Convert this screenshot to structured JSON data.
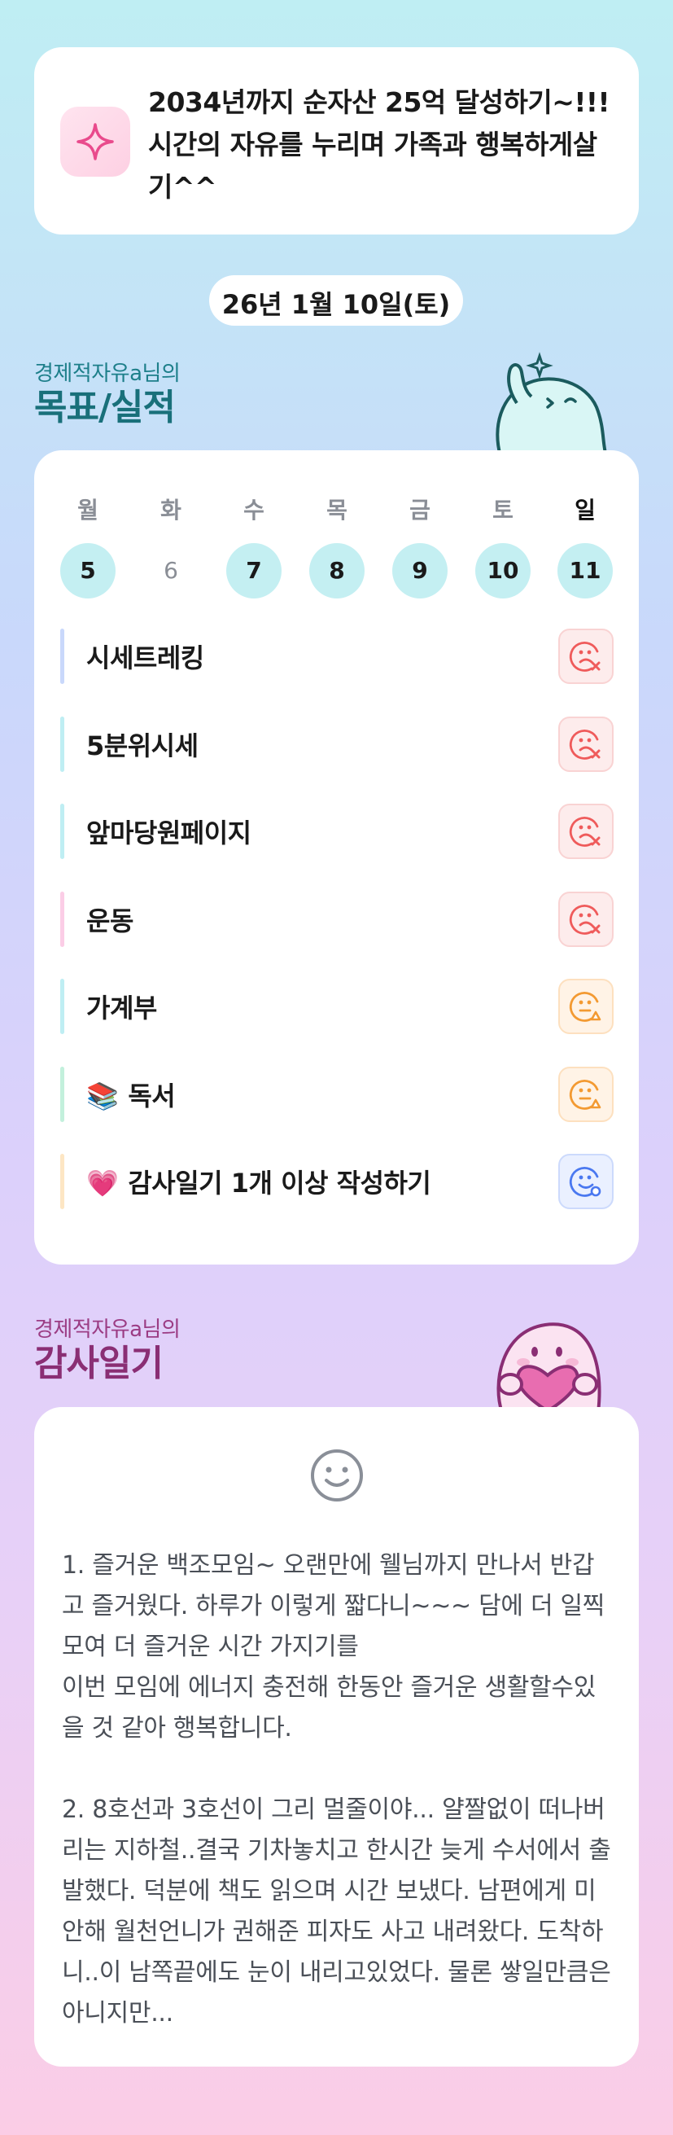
{
  "goal": {
    "icon": "sparkle-icon",
    "text": "2034년까지 순자산 25억 달성하기~!!!\n시간의 자유를 누리며 가족과 행복하게살기^^"
  },
  "date": "26년 1월 10일(토)",
  "goals_section": {
    "subtitle": "경제적자유a님의",
    "title": "목표/실적"
  },
  "week": {
    "days": [
      {
        "label": "월",
        "num": "5",
        "active": true
      },
      {
        "label": "화",
        "num": "6",
        "active": false
      },
      {
        "label": "수",
        "num": "7",
        "active": true
      },
      {
        "label": "목",
        "num": "8",
        "active": true
      },
      {
        "label": "금",
        "num": "9",
        "active": true
      },
      {
        "label": "토",
        "num": "10",
        "active": true
      },
      {
        "label": "일",
        "num": "11",
        "active": true
      }
    ]
  },
  "habits": [
    {
      "label": "시세트레킹",
      "emoji": "",
      "bar": "#c9d8fb",
      "status": "fail-face-icon"
    },
    {
      "label": "5분위시세",
      "emoji": "",
      "bar": "#bfeef3",
      "status": "fail-face-icon"
    },
    {
      "label": "앞마당원페이지",
      "emoji": "",
      "bar": "#bfeef3",
      "status": "fail-face-icon"
    },
    {
      "label": "운동",
      "emoji": "",
      "bar": "#fbcde6",
      "status": "fail-face-icon"
    },
    {
      "label": "가계부",
      "emoji": "",
      "bar": "#bfeef3",
      "status": "partial-face-icon"
    },
    {
      "label": "독서",
      "emoji": "📚",
      "bar": "#c3f0dc",
      "status": "partial-face-icon"
    },
    {
      "label": "감사일기 1개 이상 작성하기",
      "emoji": "💗",
      "bar": "#fde6c4",
      "status": "done-face-icon"
    }
  ],
  "gratitude_section": {
    "subtitle": "경제적자유a님의",
    "title": "감사일기"
  },
  "gratitude": {
    "mood_icon": "smile-face-icon",
    "text": "1. 즐거운 백조모임~ 오랜만에 웰님까지 만나서 반갑고 즐거웠다. 하루가 이렇게 짧다니~~~ 담에 더 일찍 모여 더 즐거운 시간 가지기를\n이번 모임에 에너지 충전해 한동안 즐거운 생활할수있을 것 같아 행복합니다.\n\n2. 8호선과 3호선이 그리 멀줄이야... 얄짤없이 떠나버리는 지하철..결국 기차놓치고 한시간 늦게 수서에서 출발했다. 덕분에 책도 읽으며 시간 보냈다. 남편에게 미안해  월천언니가 권해준 피자도 사고 내려왔다. 도착하니..이 남쪽끝에도 눈이 내리고있었다. 물론 쌓일만큼은 아니지만..."
  },
  "colors": {
    "fail": "#ef5b5b",
    "partial": "#f39a32",
    "done": "#4a78f0",
    "day_active": "#c4eff2"
  }
}
